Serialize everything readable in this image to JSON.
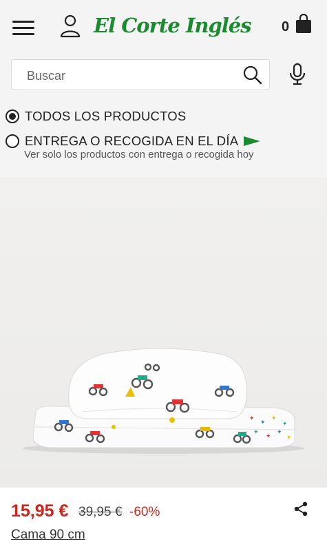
{
  "header": {
    "logo_text": "El Corte Inglés",
    "cart_count": "0"
  },
  "search": {
    "placeholder": "Buscar"
  },
  "filters": {
    "option_all": "TODOS LOS PRODUCTOS",
    "option_delivery": "ENTREGA O RECOGIDA EN EL DÍA",
    "option_delivery_sub": "Ver solo los productos con entrega o recogida hoy",
    "selected": "option_all"
  },
  "product": {
    "price_now": "15,95 €",
    "price_old": "39,95 €",
    "discount": "-60%",
    "name": "Cama 90 cm"
  },
  "colors": {
    "brand": "#1c8a2e",
    "price": "#c8281e",
    "flag": "#1c8a2e"
  }
}
